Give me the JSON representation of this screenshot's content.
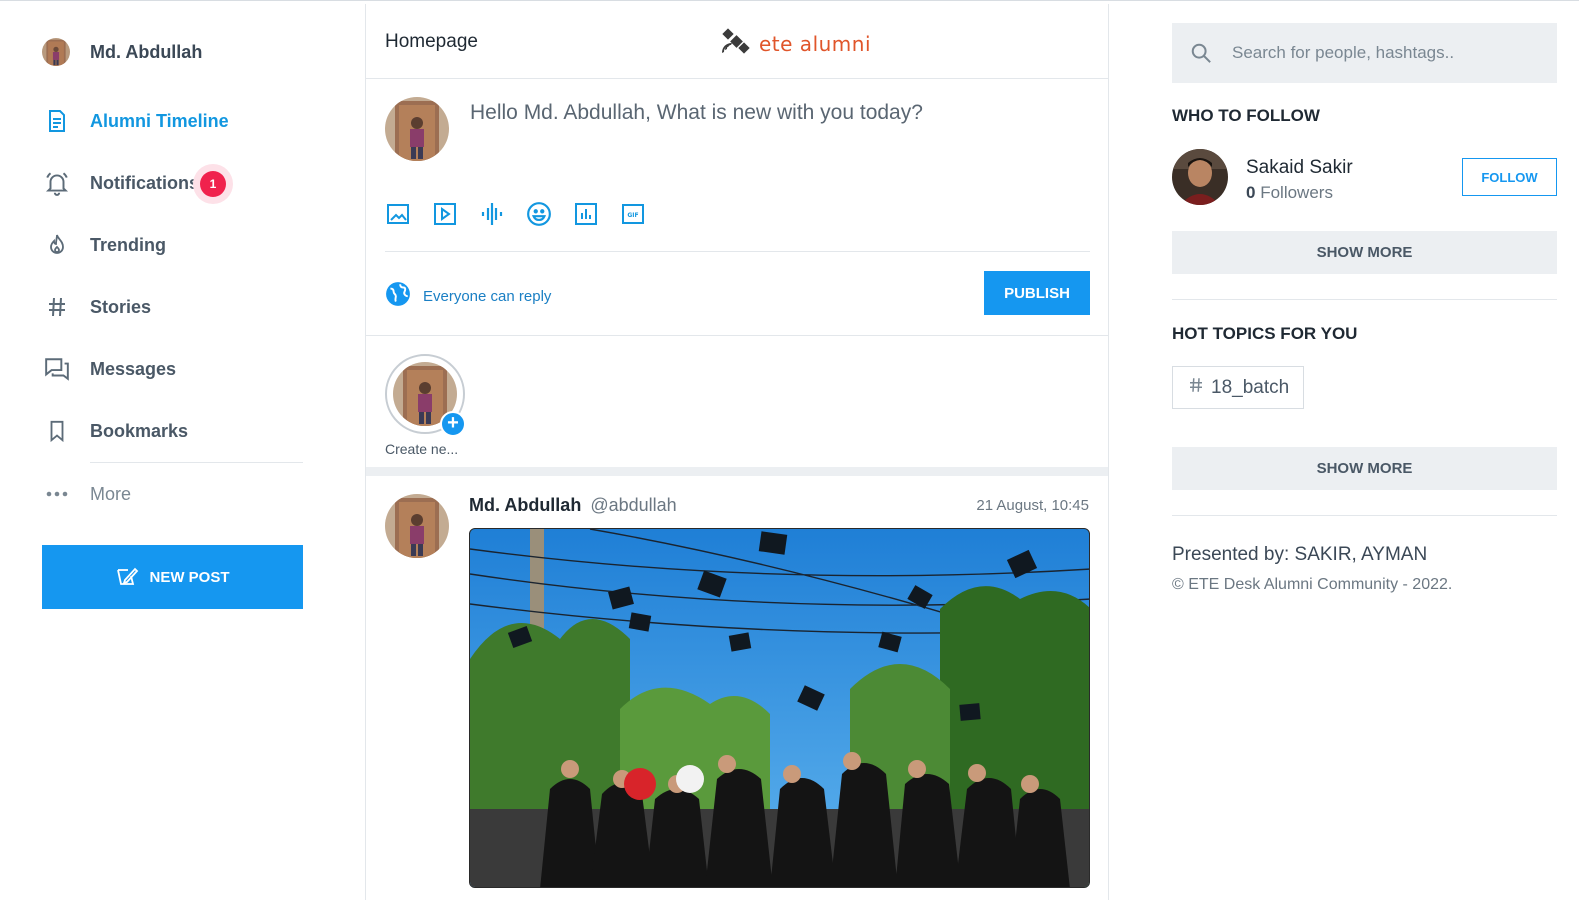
{
  "user": {
    "name": "Md. Abdullah"
  },
  "nav": {
    "items": [
      {
        "label": "Alumni Timeline",
        "icon": "document-icon"
      },
      {
        "label": "Notifications",
        "icon": "bell-icon",
        "badge": "1"
      },
      {
        "label": "Trending",
        "icon": "fire-icon"
      },
      {
        "label": "Stories",
        "icon": "hashtag-icon"
      },
      {
        "label": "Messages",
        "icon": "chat-icon"
      },
      {
        "label": "Bookmarks",
        "icon": "bookmark-icon"
      }
    ],
    "more_label": "More",
    "new_post_label": "NEW POST"
  },
  "header": {
    "title": "Homepage",
    "logo_text": "ete alumni"
  },
  "composer": {
    "placeholder": "Hello Md. Abdullah, What is new with you today?",
    "tools": [
      "image-icon",
      "video-icon",
      "audio-icon",
      "emoji-icon",
      "poll-icon",
      "gif-icon"
    ],
    "reply_setting": "Everyone can reply",
    "publish_label": "PUBLISH"
  },
  "stories": {
    "create_label": "Create ne..."
  },
  "post": {
    "author_name": "Md. Abdullah",
    "author_handle": "@abdullah",
    "timestamp": "21 August, 10:45"
  },
  "right": {
    "search_placeholder": "Search for people, hashtags..",
    "who_to_follow_title": "WHO TO FOLLOW",
    "suggestion": {
      "name": "Sakaid Sakir",
      "followers_count": "0",
      "followers_label": "Followers",
      "follow_label": "FOLLOW"
    },
    "show_more_label": "SHOW MORE",
    "hot_topics_title": "HOT TOPICS FOR YOU",
    "topics": [
      "18_batch"
    ],
    "presented_by": "Presented by: SAKIR, AYMAN",
    "copyright": "© ETE Desk Alumni Community - 2022."
  },
  "colors": {
    "accent": "#1597f0",
    "badge": "#f0224d",
    "logo": "#e0552a"
  }
}
